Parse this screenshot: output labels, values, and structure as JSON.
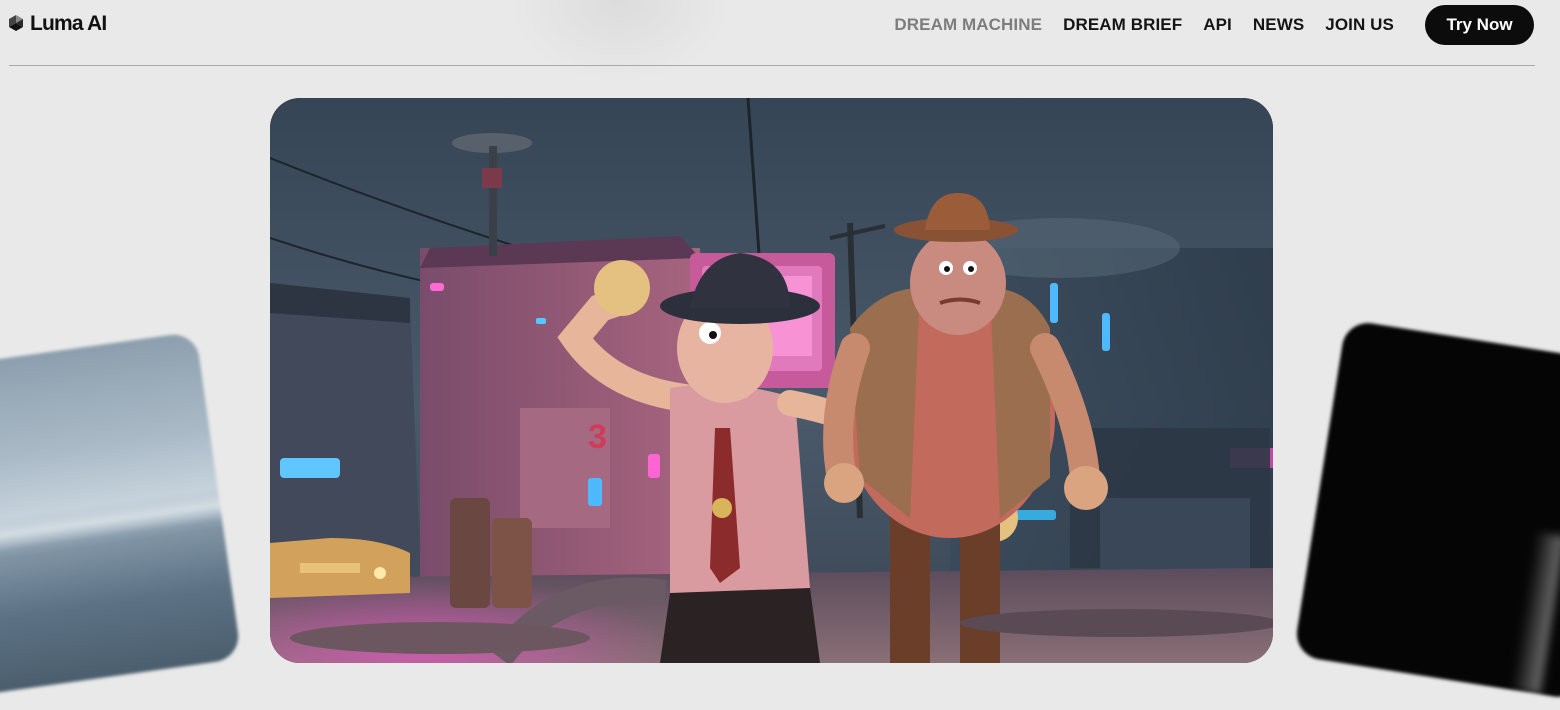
{
  "brand": {
    "name": "Luma AI",
    "logo_icon": "luma-logo-icon"
  },
  "nav": {
    "items": [
      {
        "label": "DREAM MACHINE",
        "active": true
      },
      {
        "label": "DREAM BRIEF"
      },
      {
        "label": "API"
      },
      {
        "label": "NEWS"
      },
      {
        "label": "JOIN US"
      }
    ],
    "cta_label": "Try Now"
  },
  "hero": {
    "sign_number": "3"
  },
  "colors": {
    "background": "#e9e9e9",
    "text": "#151515",
    "nav_dim": "#7d7d7d",
    "cta_bg": "#0c0c0c",
    "cta_text": "#ffffff",
    "neon_pink": "#ff4fd8",
    "neon_blue": "#3fb8ff"
  }
}
